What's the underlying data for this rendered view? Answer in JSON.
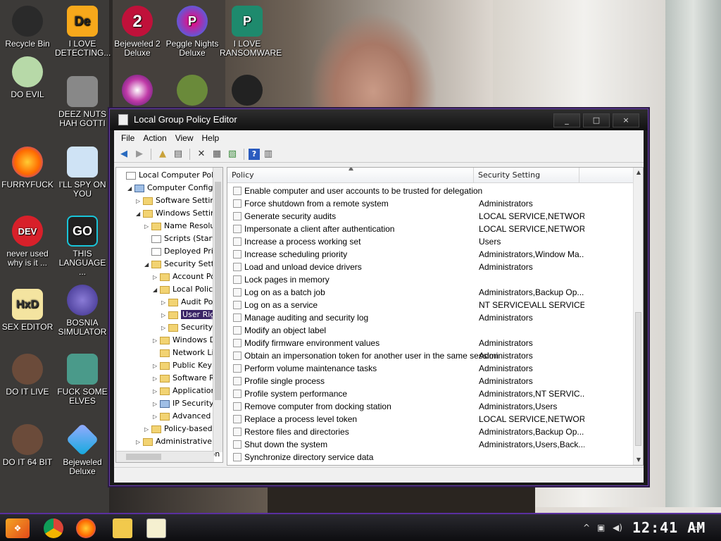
{
  "desktop": {
    "icons_col1": [
      {
        "label": "Recycle Bin",
        "icon": "recycle-bin-icon"
      },
      {
        "label": "DO EVIL",
        "icon": "character-icon"
      },
      {
        "label": "FURRYFUCK",
        "icon": "firefox-icon"
      },
      {
        "label": "never used why is it ...",
        "icon": "dev-cpp-icon"
      },
      {
        "label": "SEX EDITOR",
        "icon": "hxd-icon"
      },
      {
        "label": "DO IT LIVE",
        "icon": "portrait-icon"
      },
      {
        "label": "DO IT 64 BIT",
        "icon": "portrait-64-icon"
      }
    ],
    "icons_col2": [
      {
        "label": "I LOVE DETECTING...",
        "icon": "detect-it-easy-icon"
      },
      {
        "label": "DEEZ NUTS HAH GOTTI",
        "icon": "window-stack-icon"
      },
      {
        "label": "I'LL SPY ON YOU",
        "icon": "spy-icon"
      },
      {
        "label": "THIS LANGUAGE ...",
        "icon": "go-icon"
      },
      {
        "label": "BOSNIA SIMULATOR",
        "icon": "spiked-ball-icon"
      },
      {
        "label": "FUCK SOME ELVES",
        "icon": "santa-icon"
      },
      {
        "label": "Bejeweled Deluxe",
        "icon": "diamond-icon"
      }
    ],
    "icons_row_top": [
      {
        "label": "Bejeweled 2 Deluxe",
        "icon": "bejeweled2-icon"
      },
      {
        "label": "Peggle Nights Deluxe",
        "icon": "peggle-icon"
      },
      {
        "label": "I LOVE RANSOMWARE",
        "icon": "publisher-icon"
      }
    ],
    "icons_row_second": [
      {
        "icon": "gem-icon"
      },
      {
        "icon": "flower-icon"
      },
      {
        "icon": "dragon-icon"
      }
    ]
  },
  "window": {
    "title": "Local Group Policy Editor",
    "buttons": {
      "minimize": "_",
      "maximize": "□",
      "close": "×"
    },
    "menu": [
      "File",
      "Action",
      "View",
      "Help"
    ]
  },
  "tree": {
    "nodes": [
      {
        "label": "Local Computer Policy",
        "level": 0,
        "expander": "",
        "kind": "doc"
      },
      {
        "label": "Computer Configuration",
        "level": 1,
        "expander": "◢",
        "kind": "pc"
      },
      {
        "label": "Software Settings",
        "level": 2,
        "expander": "▷",
        "kind": "folder"
      },
      {
        "label": "Windows Settings",
        "level": 2,
        "expander": "◢",
        "kind": "folder"
      },
      {
        "label": "Name Resolution Policy",
        "level": 3,
        "expander": "▷",
        "kind": "folder"
      },
      {
        "label": "Scripts (Startup/Shutdown)",
        "level": 3,
        "expander": "",
        "kind": "doc"
      },
      {
        "label": "Deployed Printers",
        "level": 3,
        "expander": "",
        "kind": "doc"
      },
      {
        "label": "Security Settings",
        "level": 3,
        "expander": "◢",
        "kind": "lock"
      },
      {
        "label": "Account Policies",
        "level": 4,
        "expander": "▷",
        "kind": "lock"
      },
      {
        "label": "Local Policies",
        "level": 4,
        "expander": "◢",
        "kind": "lock"
      },
      {
        "label": "Audit Policy",
        "level": 5,
        "expander": "▷",
        "kind": "lock"
      },
      {
        "label": "User Rights Assignment",
        "level": 5,
        "expander": "▷",
        "kind": "lock",
        "selected": true
      },
      {
        "label": "Security Options",
        "level": 5,
        "expander": "▷",
        "kind": "lock"
      },
      {
        "label": "Windows Defender Firewall",
        "level": 4,
        "expander": "▷",
        "kind": "folder"
      },
      {
        "label": "Network List Manager",
        "level": 4,
        "expander": "",
        "kind": "folder"
      },
      {
        "label": "Public Key Policies",
        "level": 4,
        "expander": "▷",
        "kind": "folder"
      },
      {
        "label": "Software Restriction",
        "level": 4,
        "expander": "▷",
        "kind": "folder"
      },
      {
        "label": "Application Control",
        "level": 4,
        "expander": "▷",
        "kind": "folder"
      },
      {
        "label": "IP Security Policies",
        "level": 4,
        "expander": "▷",
        "kind": "pc"
      },
      {
        "label": "Advanced Audit",
        "level": 4,
        "expander": "▷",
        "kind": "folder"
      },
      {
        "label": "Policy-based QoS",
        "level": 3,
        "expander": "▷",
        "kind": "chart"
      },
      {
        "label": "Administrative Templates",
        "level": 2,
        "expander": "▷",
        "kind": "folder"
      },
      {
        "label": "User Configuration",
        "level": 1,
        "expander": "",
        "kind": "pc"
      }
    ]
  },
  "list": {
    "columns": {
      "policy": "Policy",
      "setting": "Security Setting"
    },
    "rows": [
      {
        "policy": "Enable computer and user accounts to be trusted for delegation",
        "setting": ""
      },
      {
        "policy": "Force shutdown from a remote system",
        "setting": "Administrators"
      },
      {
        "policy": "Generate security audits",
        "setting": "LOCAL SERVICE,NETWORK..."
      },
      {
        "policy": "Impersonate a client after authentication",
        "setting": "LOCAL SERVICE,NETWORK..."
      },
      {
        "policy": "Increase a process working set",
        "setting": "Users"
      },
      {
        "policy": "Increase scheduling priority",
        "setting": "Administrators,Window Ma..."
      },
      {
        "policy": "Load and unload device drivers",
        "setting": "Administrators"
      },
      {
        "policy": "Lock pages in memory",
        "setting": ""
      },
      {
        "policy": "Log on as a batch job",
        "setting": "Administrators,Backup Op..."
      },
      {
        "policy": "Log on as a service",
        "setting": "NT SERVICE\\ALL SERVICES"
      },
      {
        "policy": "Manage auditing and security log",
        "setting": "Administrators"
      },
      {
        "policy": "Modify an object label",
        "setting": ""
      },
      {
        "policy": "Modify firmware environment values",
        "setting": "Administrators"
      },
      {
        "policy": "Obtain an impersonation token for another user in the same session",
        "setting": "Administrators"
      },
      {
        "policy": "Perform volume maintenance tasks",
        "setting": "Administrators"
      },
      {
        "policy": "Profile single process",
        "setting": "Administrators"
      },
      {
        "policy": "Profile system performance",
        "setting": "Administrators,NT SERVIC..."
      },
      {
        "policy": "Remove computer from docking station",
        "setting": "Administrators,Users"
      },
      {
        "policy": "Replace a process level token",
        "setting": "LOCAL SERVICE,NETWORK..."
      },
      {
        "policy": "Restore files and directories",
        "setting": "Administrators,Backup Op..."
      },
      {
        "policy": "Shut down the system",
        "setting": "Administrators,Users,Back..."
      },
      {
        "policy": "Synchronize directory service data",
        "setting": ""
      }
    ]
  },
  "taskbar": {
    "clock": "12:41 AM",
    "apps": [
      "chrome-icon",
      "firefox-icon",
      "file-explorer-icon",
      "notepad-icon"
    ]
  }
}
